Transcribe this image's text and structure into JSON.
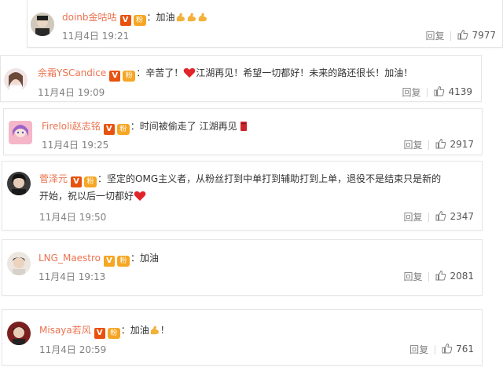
{
  "comments": [
    {
      "username": "doinb金咕咕",
      "verified": "V",
      "fan_badge": "粉",
      "separator": "：",
      "text": "加油",
      "trailing_emojis": [
        "flexed-biceps",
        "flexed-biceps",
        "flexed-biceps"
      ],
      "date": "11月4日 19:21",
      "reply_label": "回复",
      "likes": "7977"
    },
    {
      "username": "余霜YSCandice",
      "verified": "V",
      "fan_badge": "粉",
      "separator": "：",
      "text_before": "辛苦了！",
      "text_after": "江湖再见！希望一切都好！未来的路还很长！加油！",
      "inline_emoji": "red-heart",
      "date": "11月4日 19:09",
      "reply_label": "回复",
      "likes": "4139"
    },
    {
      "username": "Fireloli赵志铭",
      "verified": "V",
      "fan_badge": "粉",
      "separator": "：",
      "text": "时间被偷走了 江湖再见",
      "trailing_emoji": "red-book",
      "date": "11月4日 19:25",
      "reply_label": "回复",
      "likes": "2917"
    },
    {
      "username": "菅泽元",
      "verified": "V",
      "fan_badge": "粉",
      "separator": "：",
      "text_line1": "坚定的OMG主义者，从粉丝打到中单打到辅助打到上单，退役不是结束只是新的",
      "text_line2": "开始，祝以后一切都好",
      "trailing_emoji": "red-heart",
      "date": "11月4日 19:50",
      "reply_label": "回复",
      "likes": "2347"
    },
    {
      "username": "LNG_Maestro",
      "verified": "V",
      "fan_badge": "粉",
      "separator": "：",
      "text": "加油",
      "date": "11月4日 19:13",
      "reply_label": "回复",
      "likes": "2081"
    },
    {
      "username": "Misaya若风",
      "verified": "V",
      "fan_badge": "粉",
      "separator": "：",
      "text_before": "加油",
      "text_after": "！",
      "inline_emoji": "flexed-biceps",
      "date": "11月4日 20:59",
      "reply_label": "回复",
      "likes": "761"
    }
  ],
  "colors": {
    "username": "#eb7350",
    "meta_text": "#808080",
    "verified_red": "#e8520f",
    "verified_yellow": "#f5a623",
    "heart": "#e0242a"
  }
}
